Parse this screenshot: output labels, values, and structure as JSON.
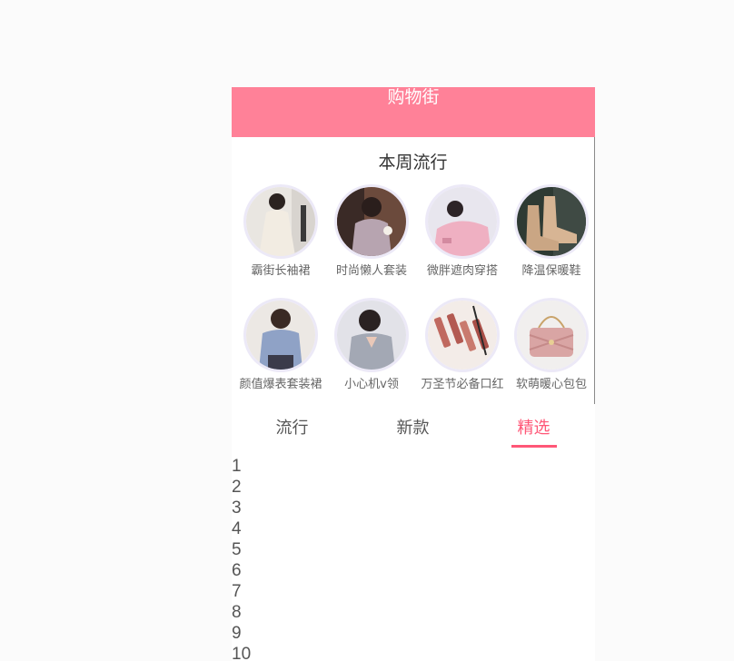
{
  "navbar": {
    "title": "购物街",
    "bg_color": "#ff8198"
  },
  "recommend": {
    "title": "本周流行",
    "items": [
      {
        "label": "霸街长袖裙",
        "icon": "dress-photo-icon"
      },
      {
        "label": "时尚懒人套装",
        "icon": "outfit-photo-icon"
      },
      {
        "label": "微胖遮肉穿搭",
        "icon": "sweater-photo-icon"
      },
      {
        "label": "降温保暖鞋",
        "icon": "boots-photo-icon"
      },
      {
        "label": "颜值爆表套装裙",
        "icon": "shirt-dress-photo-icon"
      },
      {
        "label": "小心机v领",
        "icon": "vneck-photo-icon"
      },
      {
        "label": "万圣节必备口红",
        "icon": "lipstick-photo-icon"
      },
      {
        "label": "软萌暖心包包",
        "icon": "handbag-photo-icon"
      }
    ]
  },
  "tabs": {
    "items": [
      "流行",
      "新款",
      "精选"
    ],
    "active_index": 2,
    "active_color": "#ff5777"
  },
  "list": [
    "1",
    "2",
    "3",
    "4",
    "5",
    "6",
    "7",
    "8",
    "9",
    "10"
  ]
}
